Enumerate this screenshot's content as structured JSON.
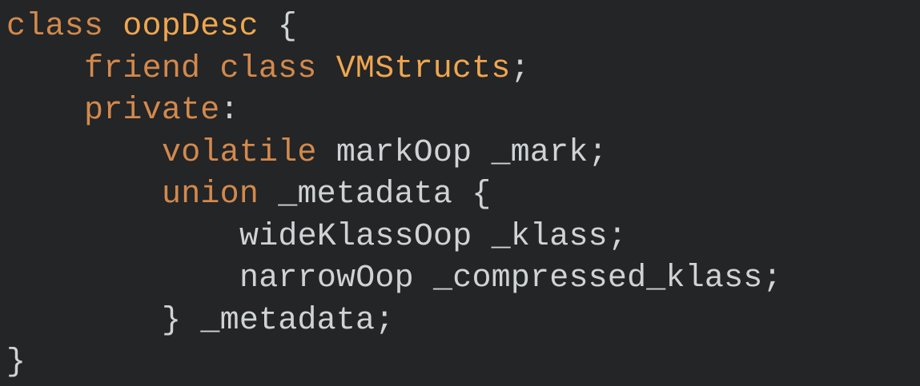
{
  "colors": {
    "background": "#232527",
    "keyword": "#d3894c",
    "type_name": "#f0a64f",
    "plain_text": "#cfd3d6"
  },
  "code": {
    "line1": {
      "kw_class": "class",
      "class_name": "oopDesc",
      "brace_open": " {"
    },
    "line2": {
      "kw_friend": "friend",
      "kw_class": "class",
      "friend_name": "VMStructs",
      "semicolon": ";"
    },
    "line3": {
      "kw_private": "private",
      "colon": ":"
    },
    "line4": {
      "kw_volatile": "volatile",
      "rest": " markOop _mark;"
    },
    "line5": {
      "kw_union": "union",
      "rest": " _metadata {"
    },
    "line6": {
      "text": "wideKlassOop _klass;"
    },
    "line7": {
      "text": "narrowOop _compressed_klass;"
    },
    "line8": {
      "text": "} _metadata;"
    },
    "line9": {
      "text": "}"
    }
  }
}
